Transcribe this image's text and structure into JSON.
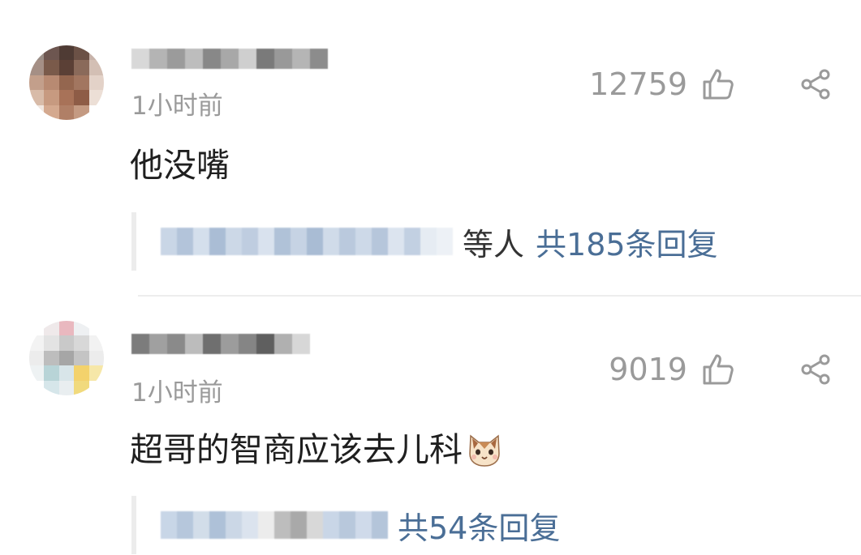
{
  "comments": [
    {
      "time": "1小时前",
      "likes": "12759",
      "text": "他没嘴",
      "replies_tail": "等人",
      "replies_link": "共185条回复"
    },
    {
      "time": "1小时前",
      "likes": "9019",
      "text": "超哥的智商应该去儿科",
      "replies_tail": "",
      "replies_link": "共54条回复"
    }
  ],
  "colors": {
    "link": "#4a6e96",
    "meta": "#9a9a9a",
    "text": "#1f1f1f"
  },
  "icons": [
    "thumbs-up-icon",
    "share-icon",
    "cat-emoji-icon"
  ]
}
